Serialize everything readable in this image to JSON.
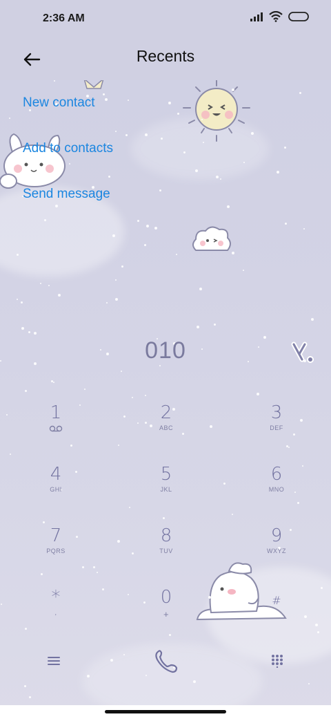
{
  "status_bar": {
    "time": "2:36 AM",
    "icons": [
      "signal-icon",
      "wifi-icon",
      "battery-icon"
    ]
  },
  "header": {
    "title": "Recents",
    "back_icon": "back-arrow-icon"
  },
  "menu": {
    "items": [
      {
        "label": "New contact"
      },
      {
        "label": "Add to contacts"
      },
      {
        "label": "Send message"
      }
    ]
  },
  "dialer": {
    "number": "010",
    "backspace_icon": "backspace-icon",
    "keys": [
      {
        "digit": "1",
        "letters": ""
      },
      {
        "digit": "2",
        "letters": "ABC"
      },
      {
        "digit": "3",
        "letters": "DEF"
      },
      {
        "digit": "4",
        "letters": "GHI"
      },
      {
        "digit": "5",
        "letters": "JKL"
      },
      {
        "digit": "6",
        "letters": "MNO"
      },
      {
        "digit": "7",
        "letters": "PQRS"
      },
      {
        "digit": "8",
        "letters": "TUV"
      },
      {
        "digit": "9",
        "letters": "WXYZ"
      },
      {
        "digit": "*",
        "letters": ","
      },
      {
        "digit": "0",
        "letters": "+"
      },
      {
        "digit": "#",
        "letters": ""
      }
    ]
  },
  "bottom_bar": {
    "menu_icon": "menu-icon",
    "call_icon": "phone-icon",
    "keypad_icon": "dialpad-icon"
  },
  "colors": {
    "link": "#1b86e0",
    "keypad": "#7272a0",
    "background": "#d2d2e2"
  }
}
